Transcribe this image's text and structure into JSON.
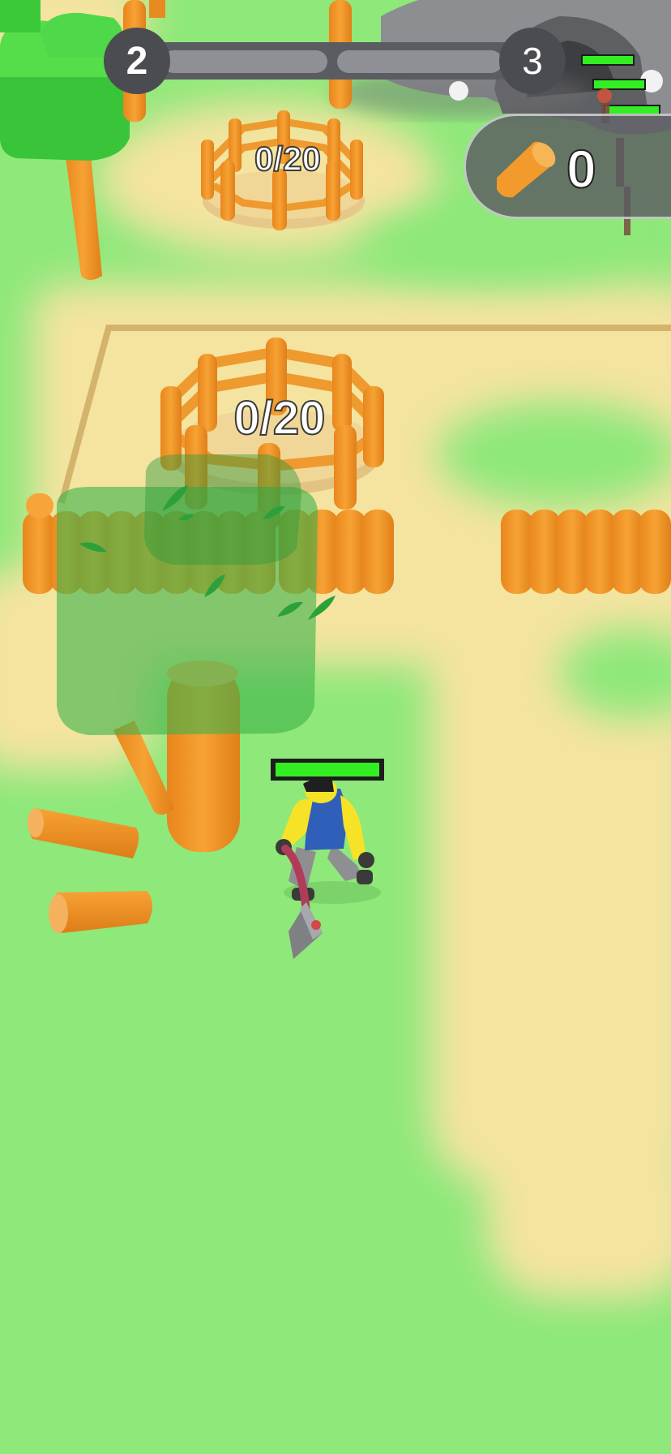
{
  "hud": {
    "current_level": "2",
    "next_level": "3",
    "level_progress": 0.0
  },
  "wood_counter": {
    "icon": "wood-log-icon",
    "count": "0"
  },
  "pens": [
    {
      "label": "0/20"
    },
    {
      "label": "0/20"
    }
  ],
  "player": {
    "health": 1.0
  },
  "colors": {
    "grass": "#8ee87a",
    "sand": "#f4e4a0",
    "wood": "#f39a2c",
    "health_green": "#33ee22",
    "hud_dark": "#4b4c51"
  }
}
